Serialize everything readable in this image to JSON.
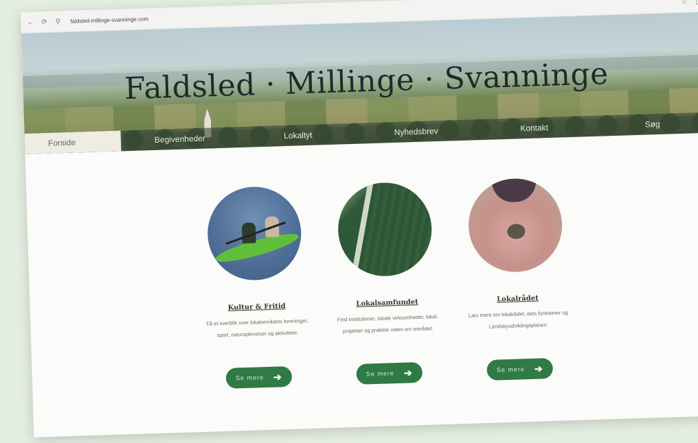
{
  "browser": {
    "url": "faldsled-millinge-svanninge.com",
    "back_icon": "←",
    "reload_icon": "⟳",
    "site_icon": "⚲",
    "ext_icons": [
      "☆",
      "◫"
    ]
  },
  "hero": {
    "title": "Faldsled · Millinge · Svanninge"
  },
  "menu": {
    "items": [
      "Forside",
      "Begivenheder",
      "Lokaltyt",
      "Nyhedsbrev",
      "Kontakt",
      "Søg"
    ]
  },
  "cards": [
    {
      "title": "Kultur & Fritid",
      "desc": "Få et overblik over lokalområdets foreninger, sport, naturoplevelser og aktiviteter.",
      "button": "Se mere"
    },
    {
      "title": "Lokalsamfundet",
      "desc": "Find institutioner, lokale virksomheder, lokal-projekter og praktisk viden om området.",
      "button": "Se mere"
    },
    {
      "title": "Lokalrådet",
      "desc": "Læs mere om lokalrådet, dets funktioner og Landsbyudviklingsplanen.",
      "button": "Se mere"
    }
  ],
  "colors": {
    "button_green": "#2f7a45",
    "page_bg": "#e4eee0"
  }
}
